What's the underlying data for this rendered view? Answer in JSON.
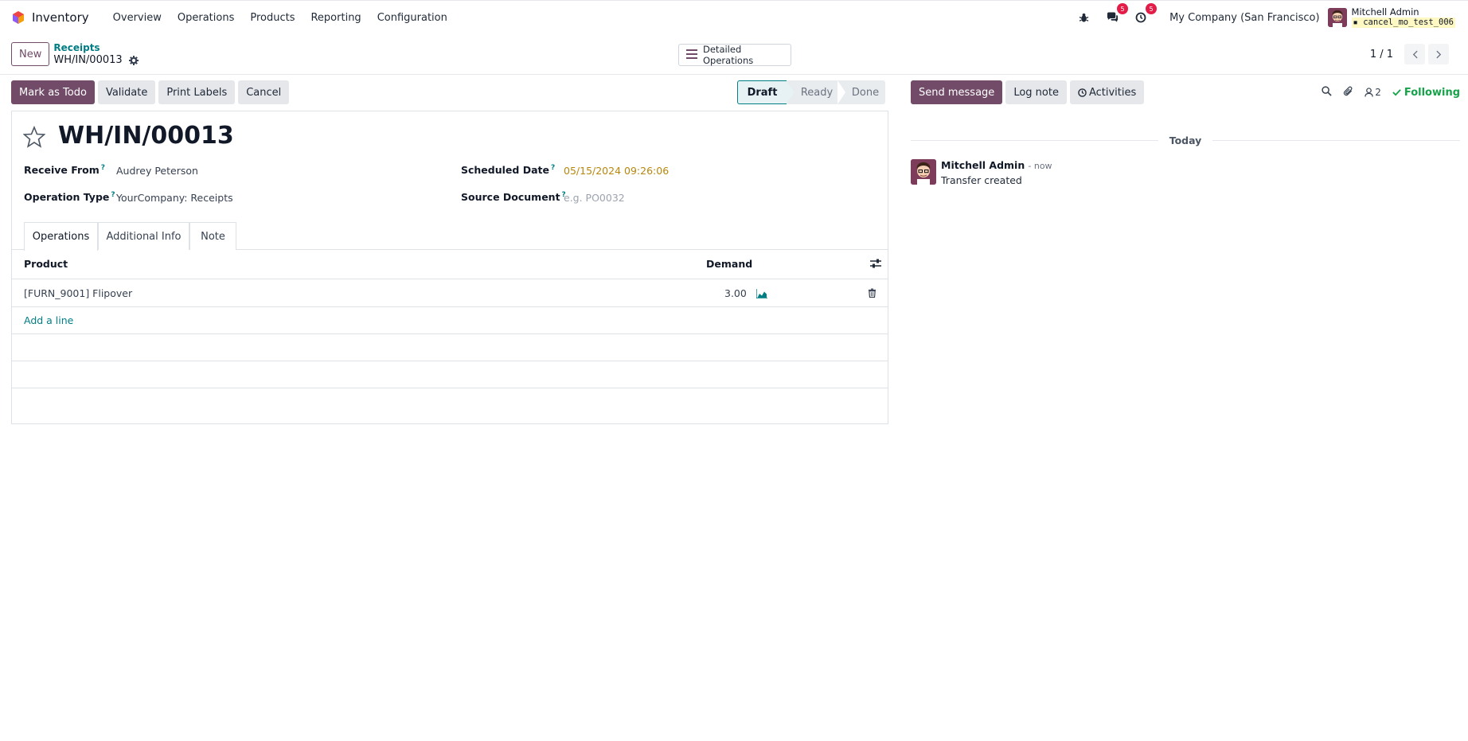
{
  "navbar": {
    "app_name": "Inventory",
    "menu": [
      "Overview",
      "Operations",
      "Products",
      "Reporting",
      "Configuration"
    ],
    "messages_badge": "5",
    "activities_badge": "5",
    "company": "My Company (San Francisco)",
    "user_name": "Mitchell Admin",
    "database": "cancel_mo_test_006"
  },
  "control_panel": {
    "new_label": "New",
    "breadcrumb_parent": "Receipts",
    "breadcrumb_current": "WH/IN/00013",
    "detailed_operations_label": "Detailed Operations",
    "pager_value": "1 / 1"
  },
  "actions": {
    "mark_as_todo": "Mark as Todo",
    "validate": "Validate",
    "print_labels": "Print Labels",
    "cancel": "Cancel"
  },
  "statusbar": {
    "draft": "Draft",
    "ready": "Ready",
    "done": "Done"
  },
  "form": {
    "title": "WH/IN/00013",
    "receive_from_label": "Receive From",
    "receive_from_value": "Audrey Peterson",
    "operation_type_label": "Operation Type",
    "operation_type_value": "YourCompany: Receipts",
    "scheduled_date_label": "Scheduled Date",
    "scheduled_date_value": "05/15/2024 09:26:06",
    "source_document_label": "Source Document",
    "source_document_placeholder": "e.g. PO0032",
    "help_mark": "?"
  },
  "tabs": [
    "Operations",
    "Additional Info",
    "Note"
  ],
  "operations_table": {
    "col_product": "Product",
    "col_demand": "Demand",
    "rows": [
      {
        "product": "[FURN_9001] Flipover",
        "demand": "3.00"
      }
    ],
    "add_line": "Add a line"
  },
  "chatter": {
    "send_message": "Send message",
    "log_note": "Log note",
    "activities": "Activities",
    "followers_count": "2",
    "following": "Following",
    "date_separator": "Today",
    "messages": [
      {
        "author": "Mitchell Admin",
        "time": "- now",
        "body": "Transfer created"
      }
    ]
  },
  "colors": {
    "brand": "#714b67",
    "accent": "#017e84",
    "warning": "#b8860b",
    "success": "#16a34a",
    "badge": "#e11d48"
  }
}
